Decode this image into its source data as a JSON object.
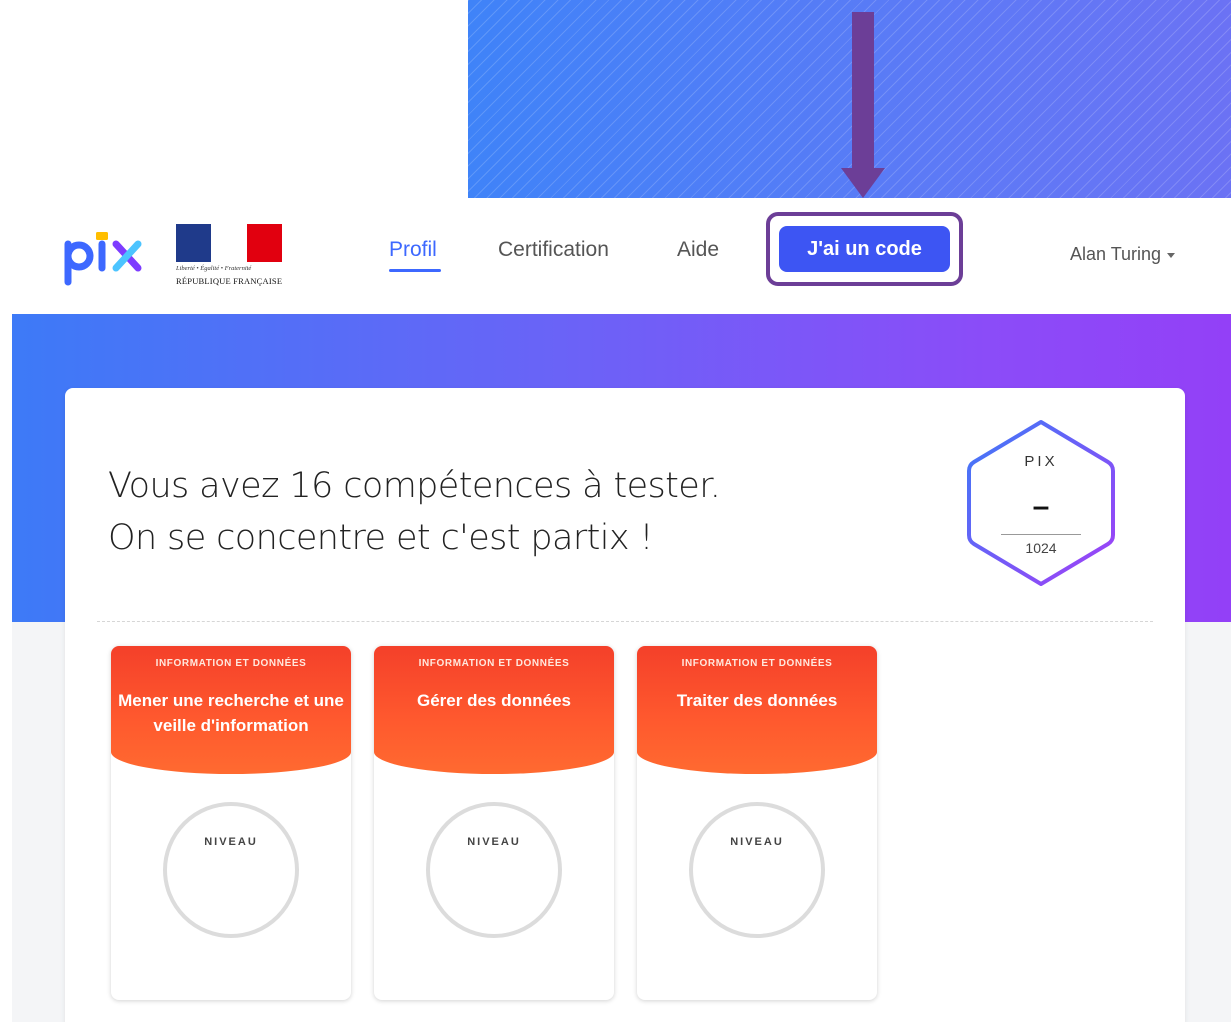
{
  "navbar": {
    "brand": "pix",
    "government_logo": {
      "motto": "Liberté • Égalité • Fraternité",
      "name": "RÉPUBLIQUE FRANÇAISE"
    },
    "links": [
      {
        "label": "Profil",
        "active": true
      },
      {
        "label": "Certification",
        "active": false
      },
      {
        "label": "Aide",
        "active": false
      }
    ],
    "code_button": "J'ai un code",
    "user_menu": "Alan Turing"
  },
  "intro": {
    "line1": "Vous avez 16 compétences à tester.",
    "line2": "On se concentre et c'est partix !"
  },
  "score_badge": {
    "label": "PIX",
    "score": "–",
    "max": "1024"
  },
  "competences": [
    {
      "area": "INFORMATION ET DONNÉES",
      "name": "Mener une recherche et une veille d'information",
      "level_label": "NIVEAU"
    },
    {
      "area": "INFORMATION ET DONNÉES",
      "name": "Gérer des données",
      "level_label": "NIVEAU"
    },
    {
      "area": "INFORMATION ET DONNÉES",
      "name": "Traiter des données",
      "level_label": "NIVEAU"
    }
  ],
  "colors": {
    "primary": "#3d68ff",
    "code_button": "#3d55f3",
    "annotation": "#6c3e97",
    "competence_header": "#ff5a2e",
    "hero_start": "#3d7af7",
    "hero_end": "#9340f7"
  },
  "icons": {
    "annotation_arrow": "arrow-down-icon",
    "user_menu_caret": "caret-down-icon"
  }
}
